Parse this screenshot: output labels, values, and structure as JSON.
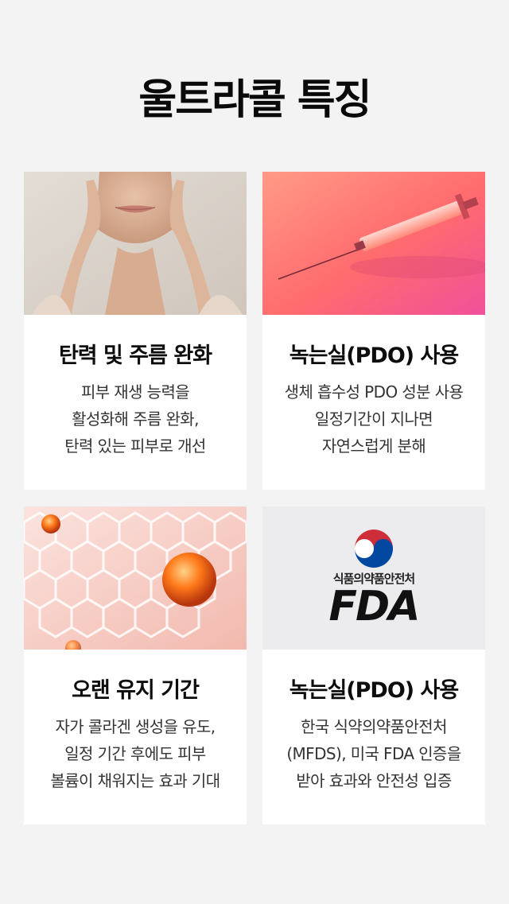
{
  "page": {
    "title": "울트라콜 특징"
  },
  "cards": [
    {
      "title": "탄력 및 주름 완화",
      "description": [
        "피부 재생 능력을",
        "활성화해 주름 완화,",
        "탄력 있는 피부로 개선"
      ],
      "image": "face-hands-photo"
    },
    {
      "title": "녹는실(PDO) 사용",
      "description": [
        "생체 흡수성 PDO 성분 사용",
        "일정기간이 지나면",
        "자연스럽게 분해"
      ],
      "image": "syringe-photo"
    },
    {
      "title": "오랜 유지 기간",
      "description": [
        "자가 콜라겐 생성을 유도,",
        "일정 기간 후에도 피부",
        "볼륨이 채워지는 효과 기대"
      ],
      "image": "collagen-hexagon-photo"
    },
    {
      "title": "녹는실(PDO) 사용",
      "description": [
        "한국 식약의약품안전처",
        "(MFDS), 미국 FDA 인증을",
        "받아 효과와 안전성 입증"
      ],
      "image": "mfds-fda-logo",
      "logo": {
        "mfds_label": "식품의약품안전처",
        "fda_text": "FDA"
      }
    }
  ],
  "colors": {
    "background": "#f3f3f3",
    "card": "#ffffff",
    "syringe_gradient": [
      "#ff7a6b",
      "#f25a8a"
    ],
    "collagen_orb": "#ff7a1a"
  }
}
